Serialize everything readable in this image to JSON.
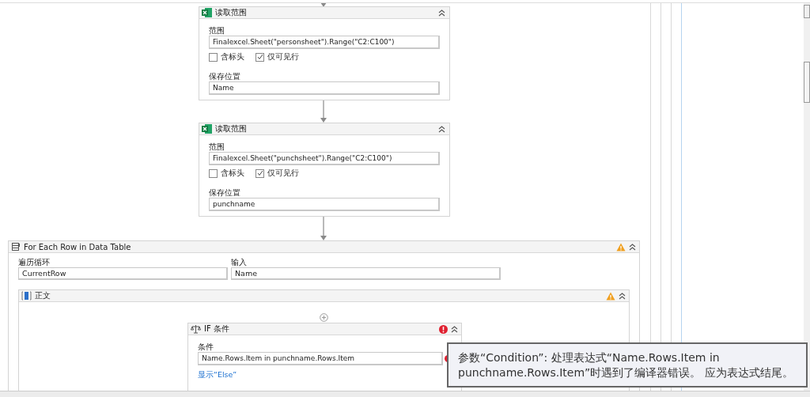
{
  "activities": [
    {
      "kind": "read_range",
      "title": "读取范围",
      "range_label": "范围",
      "range": "Finalexcel.Sheet(\"personsheet\").Range(\"C2:C100\")",
      "options": [
        {
          "label": "含标头",
          "checked": false
        },
        {
          "label": "仅可见行",
          "checked": true
        }
      ],
      "save_label": "保存位置",
      "save": "Name"
    },
    {
      "kind": "read_range",
      "title": "读取范围",
      "range_label": "范围",
      "range": "Finalexcel.Sheet(\"punchsheet\").Range(\"C2:C100\")",
      "options": [
        {
          "label": "含标头",
          "checked": false
        },
        {
          "label": "仅可见行",
          "checked": true
        }
      ],
      "save_label": "保存位置",
      "save": "punchname"
    }
  ],
  "for_each": {
    "title": "For Each Row in Data Table",
    "warning": true,
    "loop_label": "遍历循环",
    "loop": "CurrentRow",
    "input_label": "输入",
    "input": "Name",
    "body": {
      "title": "正文",
      "warning": true,
      "if": {
        "title": "IF 条件",
        "error": true,
        "condition_label": "条件",
        "condition": "Name.Rows.Item in punchname.Rows.Item",
        "field_error": true,
        "else_link": "显示“Else”"
      }
    }
  },
  "tooltip": {
    "line_1": "参数“Condition”: 处理表达式“Name.Rows.Item in",
    "line_2": "punchname.Rows.Item”时遇到了编译器错误。 应为表达式结尾。"
  }
}
